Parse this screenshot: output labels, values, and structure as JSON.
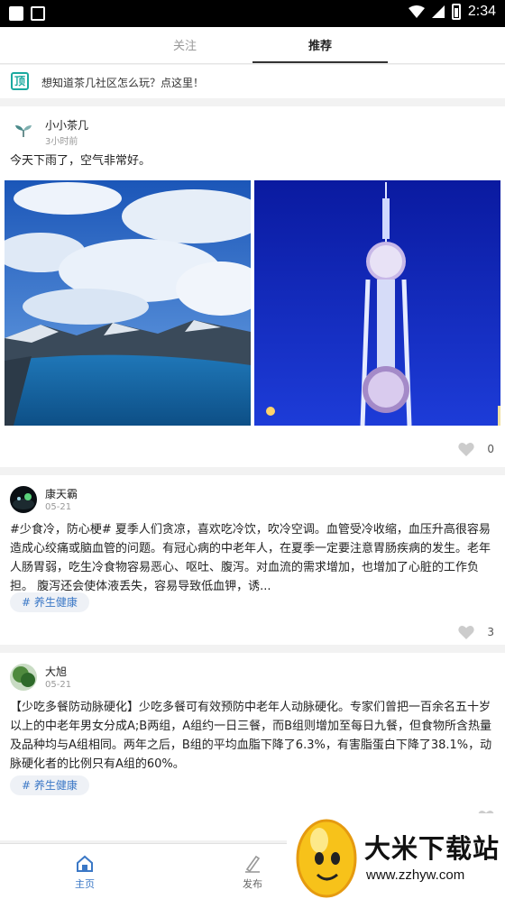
{
  "status_bar": {
    "time": "2:34"
  },
  "tabs": {
    "follow": "关注",
    "recommend": "推荐"
  },
  "notice": {
    "icon_char": "顶",
    "text": "想知道茶几社区怎么玩？点这里！"
  },
  "posts": [
    {
      "user": "小小茶几",
      "time": "3小时前",
      "text": "今天下雨了，空气非常好。",
      "likes": "0"
    },
    {
      "user": "康天霸",
      "time": "05-21",
      "text": "#少食冷，防心梗# 夏季人们贪凉，喜欢吃冷饮，吹冷空调。血管受冷收缩，血压升高很容易造成心绞痛或脑血管的问题。有冠心病的中老年人，在夏季一定要注意胃肠疾病的发生。老年人肠胃弱，吃生冷食物容易恶心、呕吐、腹泻。对血流的需求增加，也增加了心脏的工作负担。 腹泻还会使体液丢失，容易导致低血钾，诱...",
      "tag": "# 养生健康",
      "likes": "3"
    },
    {
      "user": "大旭",
      "time": "05-21",
      "text": "【少吃多餐防动脉硬化】少吃多餐可有效预防中老年人动脉硬化。专家们曾把一百余名五十岁以上的中老年男女分成A;B两组，A组约一日三餐，而B组则增加至每日九餐，但食物所含热量及品种均与A组相同。两年之后，B组的平均血脂下降了6.3%，有害脂蛋白下降了38.1%，动脉硬化者的比例只有A组的60%。",
      "tag": "# 养生健康"
    }
  ],
  "bottom_nav": {
    "home": "主页",
    "publish": "发布"
  },
  "watermark": {
    "title": "大米下载站",
    "url": "www.zzhyw.com"
  },
  "colors": {
    "accent": "#3b78c6",
    "notice_icon": "#1aa99f"
  }
}
